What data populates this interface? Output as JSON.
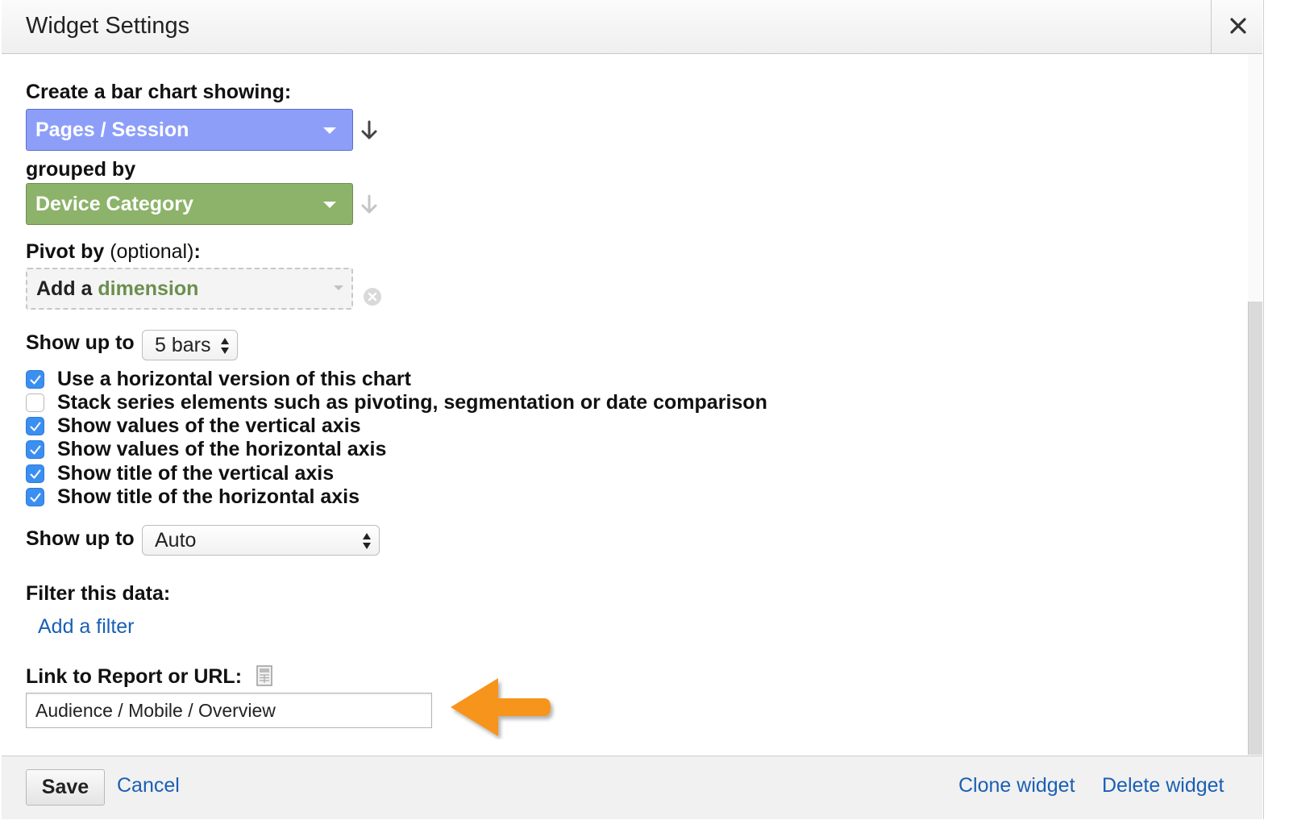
{
  "dialog": {
    "title": "Widget Settings"
  },
  "chart": {
    "metric_label": "Create a bar chart showing:",
    "metric_value": "Pages / Session",
    "group_label": "grouped by",
    "group_value": "Device Category",
    "pivot_label_bold": "Pivot by",
    "pivot_label_light": "(optional)",
    "pivot_label_colon": ":",
    "pivot_placeholder_prefix": "Add a",
    "pivot_placeholder_word": "dimension"
  },
  "options": {
    "show_up_to_label": "Show up to",
    "bars_value": "5 bars",
    "checkboxes": [
      {
        "label": "Use a horizontal version of this chart",
        "checked": true
      },
      {
        "label": "Stack series elements such as pivoting, segmentation or date comparison",
        "checked": false
      },
      {
        "label": "Show values of the vertical axis",
        "checked": true
      },
      {
        "label": "Show values of the horizontal axis",
        "checked": true
      },
      {
        "label": "Show title of the vertical axis",
        "checked": true
      },
      {
        "label": "Show title of the horizontal axis",
        "checked": true
      }
    ],
    "show_up_to_label_2": "Show up to",
    "auto_value": "Auto"
  },
  "filter": {
    "label": "Filter this data:",
    "add_filter": "Add a filter"
  },
  "link": {
    "label": "Link to Report or URL:",
    "value": "Audience / Mobile / Overview"
  },
  "footer": {
    "save": "Save",
    "cancel": "Cancel",
    "clone": "Clone widget",
    "delete": "Delete widget"
  },
  "colors": {
    "metric_select": "#8d9ef9",
    "dimension_select": "#8cb369",
    "checkbox_checked": "#3b8ff0",
    "link": "#1a5fb4",
    "annotation_arrow": "#f7941d"
  }
}
